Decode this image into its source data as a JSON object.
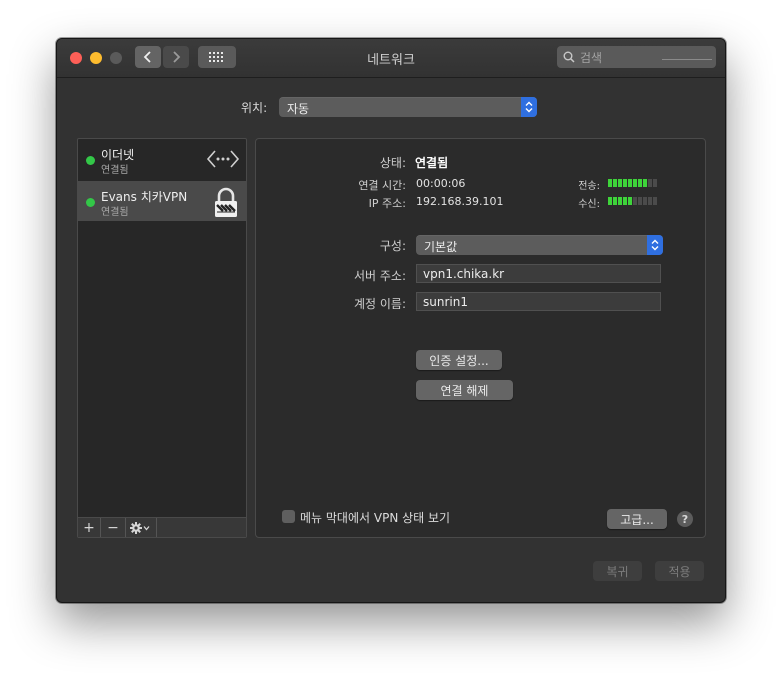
{
  "window": {
    "title": "네트워크",
    "search": {
      "placeholder": "검색"
    }
  },
  "location": {
    "label": "위치:",
    "value": "자동"
  },
  "services": [
    {
      "name": "이더넷",
      "status": "연결됨",
      "status_color": "#33c748",
      "icon": "ethernet-arrows-icon"
    },
    {
      "name": "Evans 치카VPN",
      "status": "연결됨",
      "status_color": "#33c748",
      "icon": "vpn-lock-icon"
    }
  ],
  "list_toolbar": {
    "add": "+",
    "remove": "−"
  },
  "detail": {
    "status": {
      "label": "상태:",
      "value": "연결됨"
    },
    "connect_time": {
      "label": "연결 시간:",
      "value": "00:00:06"
    },
    "ip": {
      "label": "IP 주소:",
      "value": "192.168.39.101"
    },
    "transmit": {
      "label": "전송:",
      "level_segments": 8,
      "total_segments": 10
    },
    "receive": {
      "label": "수신:",
      "level_segments": 5,
      "total_segments": 10
    },
    "configuration": {
      "label": "구성:",
      "value": "기본값"
    },
    "server": {
      "label": "서버 주소:",
      "value": "vpn1.chika.kr"
    },
    "account": {
      "label": "계정 이름:",
      "value": "sunrin1"
    },
    "auth_button": "인증 설정...",
    "disconnect_button": "연결 해제",
    "show_in_menubar": {
      "label": "메뉴 막대에서 VPN 상태 보기",
      "checked": false
    },
    "advanced_button": "고급...",
    "help": "?"
  },
  "footer": {
    "revert": "복귀",
    "apply": "적용"
  },
  "colors": {
    "accent": "#2f6fe0",
    "connected": "#33c748",
    "meter_on": "#3ed43a"
  }
}
